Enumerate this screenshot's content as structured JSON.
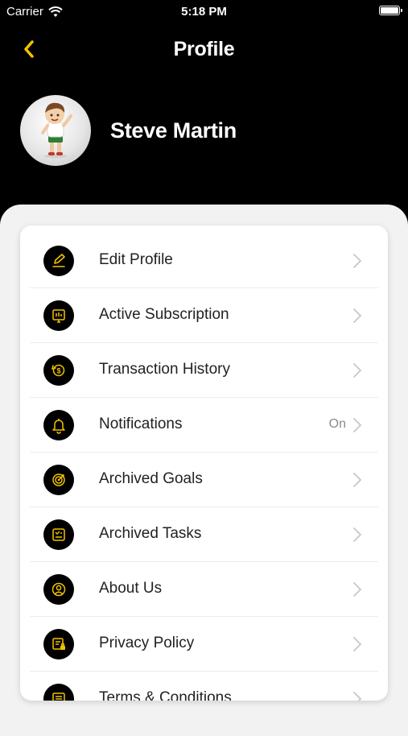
{
  "status_bar": {
    "carrier": "Carrier",
    "time": "5:18 PM"
  },
  "header": {
    "title": "Profile"
  },
  "profile": {
    "name": "Steve Martin"
  },
  "colors": {
    "accent": "#f2c200",
    "header_bg": "#000000",
    "sheet_bg": "#f2f2f2"
  },
  "menu": [
    {
      "label": "Edit Profile",
      "value": "",
      "icon": "edit-profile-icon"
    },
    {
      "label": "Active Subscription",
      "value": "",
      "icon": "subscription-icon"
    },
    {
      "label": "Transaction History",
      "value": "",
      "icon": "transaction-history-icon"
    },
    {
      "label": "Notifications",
      "value": "On",
      "icon": "bell-icon"
    },
    {
      "label": "Archived Goals",
      "value": "",
      "icon": "target-icon"
    },
    {
      "label": "Archived Tasks",
      "value": "",
      "icon": "tasks-icon"
    },
    {
      "label": "About Us",
      "value": "",
      "icon": "user-circle-icon"
    },
    {
      "label": "Privacy Policy",
      "value": "",
      "icon": "privacy-icon"
    },
    {
      "label": "Terms & Conditions",
      "value": "",
      "icon": "terms-icon"
    }
  ]
}
